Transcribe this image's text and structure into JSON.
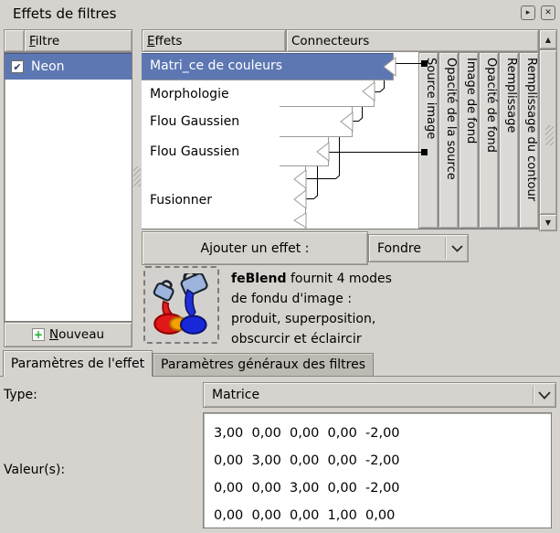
{
  "titlebar": {
    "title": "Effets de filtres"
  },
  "icons": {
    "detach_glyph": "▸",
    "close_glyph": "✕",
    "scroll_up_glyph": "▲",
    "scroll_down_glyph": "▼",
    "check_glyph": "✔",
    "plus_glyph": "+"
  },
  "colors": {
    "selection_blue": "#5d77b2",
    "background_grey": "#d6d3ce",
    "plus_green": "#1fae2f",
    "connector_black": "#000000",
    "diagram_grey": "#9b9a96"
  },
  "filters_panel": {
    "header_filter_first": "F",
    "header_filter_rest": "iltre",
    "row_neon": "Neon",
    "new_first": "N",
    "new_rest": "ouveau"
  },
  "effects_panel": {
    "header_effects_first": "E",
    "header_effects_rest": "ffets",
    "header_connectors": "Connecteurs",
    "primitives": [
      "Matri_ce de couleurs",
      "Morphologie",
      "Flou Gaussien",
      "Flou Gaussien",
      "Fusionner"
    ],
    "input_columns": [
      "Source image",
      "Opacité de la source",
      "Image de fond",
      "Opacité de fond",
      "Remplissage",
      "Remplissage du contour"
    ],
    "add_button": "Ajouter un effet :",
    "add_combo_value": "Fondre",
    "info_name": "feBlend",
    "info_line1_rest": " fournit 4 modes",
    "info_line2": "de fondu d'image :",
    "info_line3": "produit, superposition,",
    "info_line4": "obscurcir et éclaircir"
  },
  "tabs": {
    "effect": "Paramètres de l'effet",
    "general": "Paramètres généraux des filtres"
  },
  "settings": {
    "type_label": "Type:",
    "type_value": "Matrice",
    "values_label": "Valeur(s):",
    "matrix_rows": [
      "3,00  0,00  0,00  0,00  -2,00",
      "0,00  3,00  0,00  0,00  -2,00",
      "0,00  0,00  3,00  0,00  -2,00",
      "0,00  0,00  0,00  1,00  0,00"
    ]
  }
}
